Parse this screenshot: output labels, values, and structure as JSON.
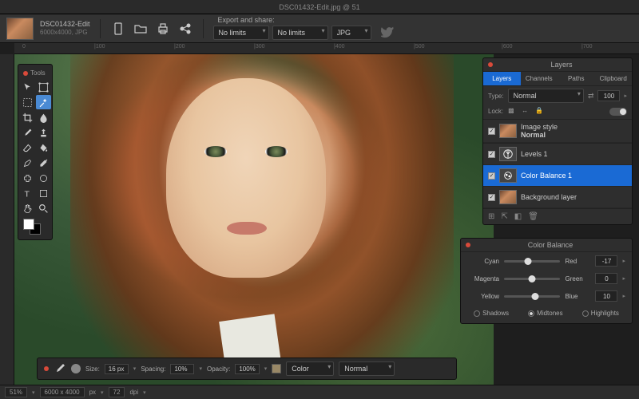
{
  "title": "DSC01432-Edit.jpg @ 51",
  "file": {
    "name": "DSC01432-Edit",
    "meta": "6000x4000,  JPG"
  },
  "export": {
    "label": "Export and share:",
    "limits1": "No limits",
    "limits2": "No limits",
    "format": "JPG"
  },
  "rulerH": [
    "0",
    "|100",
    "|200",
    "|300",
    "|400",
    "|500",
    "|600",
    "|700"
  ],
  "tools": {
    "title": "Tools"
  },
  "layers": {
    "title": "Layers",
    "tabs": [
      "Layers",
      "Channels",
      "Paths",
      "Clipboard"
    ],
    "typeLabel": "Type:",
    "blend": "Normal",
    "opacity": "100",
    "lockLabel": "Lock:",
    "imgStyle": {
      "label": "Image style",
      "mode": "Normal"
    },
    "items": [
      {
        "name": "Levels  1"
      },
      {
        "name": "Color Balance  1"
      },
      {
        "name": "Background layer"
      }
    ]
  },
  "colorBalance": {
    "title": "Color Balance",
    "rows": [
      {
        "left": "Cyan",
        "right": "Red",
        "val": "-17",
        "pos": 42
      },
      {
        "left": "Magenta",
        "right": "Green",
        "val": "0",
        "pos": 50
      },
      {
        "left": "Yellow",
        "right": "Blue",
        "val": "10",
        "pos": 55
      }
    ],
    "tones": {
      "shadows": "Shadows",
      "midtones": "Midtones",
      "highlights": "Highlights",
      "selected": "midtones"
    }
  },
  "brush": {
    "sizeLabel": "Size:",
    "size": "16 px",
    "spacingLabel": "Spacing:",
    "spacing": "10%",
    "opacityLabel": "Opacity:",
    "opacity": "100%",
    "colorLabel": "Color",
    "blend": "Normal"
  },
  "status": {
    "zoom": "51%",
    "dims": "6000 x 4000",
    "unit": "px",
    "res": "72",
    "resUnit": "dpi"
  }
}
